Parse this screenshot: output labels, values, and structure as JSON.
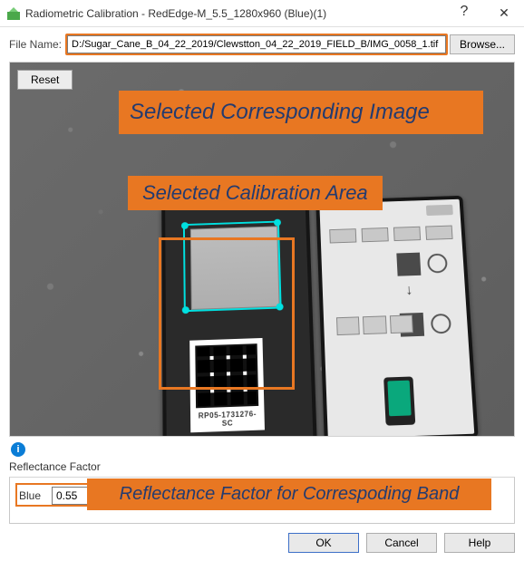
{
  "titlebar": {
    "title": "Radiometric Calibration - RedEdge-M_5.5_1280x960 (Blue)(1)",
    "help_glyph": "?",
    "close_glyph": "✕"
  },
  "file": {
    "label": "File Name:",
    "path": "D:/Sugar_Cane_B_04_22_2019/Clewstton_04_22_2019_FIELD_B/IMG_0058_1.tif",
    "browse_label": "Browse..."
  },
  "image_panel": {
    "reset_label": "Reset",
    "qr_text": "RP05-1731276-SC"
  },
  "annotations": {
    "selected_image": "Selected Corresponding Image",
    "selected_area": "Selected Calibration Area",
    "reflectance": "Reflectance Factor for Correspoding Band"
  },
  "reflectance": {
    "section_label": "Reflectance Factor",
    "info_glyph": "i",
    "band_label": "Blue",
    "value": "0.55"
  },
  "buttons": {
    "ok": "OK",
    "cancel": "Cancel",
    "help": "Help"
  }
}
